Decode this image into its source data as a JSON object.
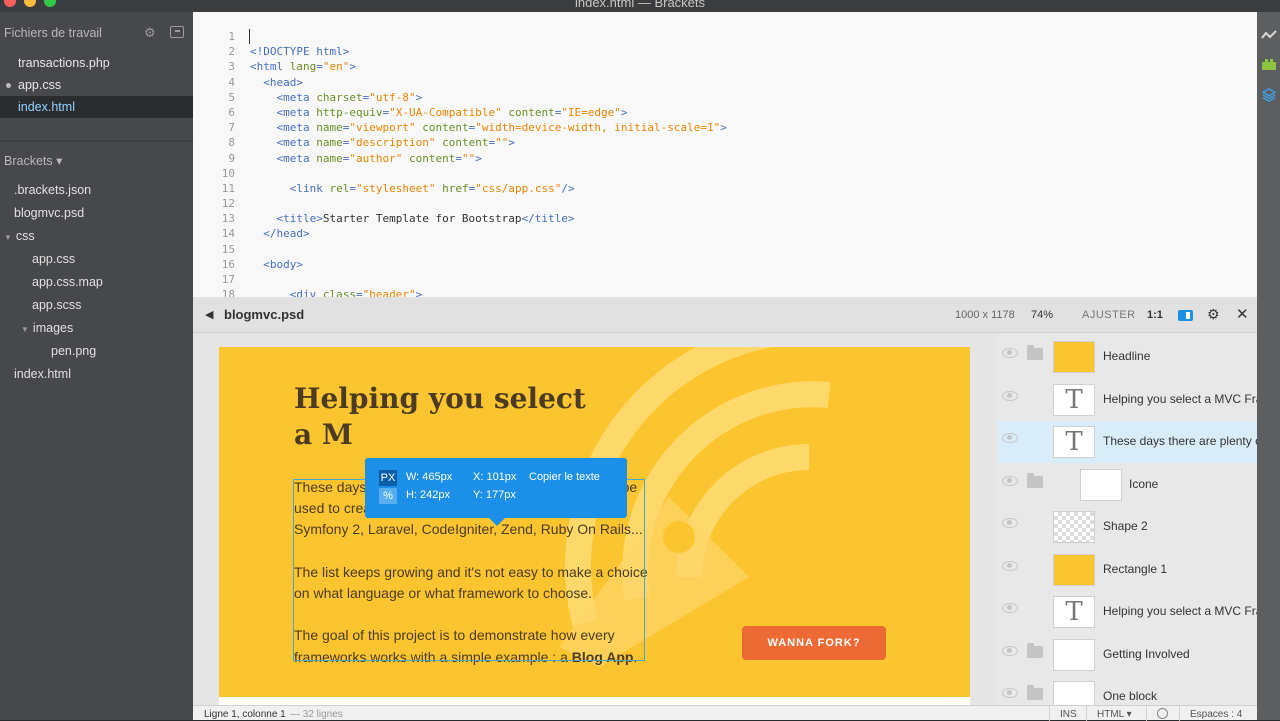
{
  "window": {
    "title": "index.html — Brackets"
  },
  "sidebar": {
    "working_files_header": "Fichiers de travail",
    "working_files": [
      {
        "name": "transactions.php",
        "active": false,
        "modified": false
      },
      {
        "name": "app.css",
        "active": false,
        "modified": true
      },
      {
        "name": "index.html",
        "active": true,
        "modified": false
      }
    ],
    "project_header": "Brackets ▾",
    "tree": [
      {
        "name": ".brackets.json"
      },
      {
        "name": "blogmvc.psd"
      },
      {
        "name": "css"
      },
      {
        "name": "app.css"
      },
      {
        "name": "app.css.map"
      },
      {
        "name": "app.scss"
      },
      {
        "name": "images"
      },
      {
        "name": "pen.png"
      },
      {
        "name": "index.html"
      }
    ]
  },
  "editor": {
    "line_numbers": [
      "1",
      "2",
      "3",
      "4",
      "5",
      "6",
      "7",
      "8",
      "9",
      "10",
      "11",
      "12",
      "13",
      "14",
      "15",
      "16",
      "17",
      "18"
    ],
    "lines": [
      [],
      [
        {
          "t": "tag",
          "v": "<!DOCTYPE html>"
        }
      ],
      [
        {
          "t": "tag",
          "v": "<html "
        },
        {
          "t": "attr",
          "v": "lang"
        },
        {
          "t": "tag",
          "v": "="
        },
        {
          "t": "str",
          "v": "\"en\""
        },
        {
          "t": "tag",
          "v": ">"
        }
      ],
      [
        {
          "t": "p",
          "v": "  "
        },
        {
          "t": "tag",
          "v": "<head>"
        }
      ],
      [
        {
          "t": "p",
          "v": "    "
        },
        {
          "t": "tag",
          "v": "<meta "
        },
        {
          "t": "attr",
          "v": "charset"
        },
        {
          "t": "tag",
          "v": "="
        },
        {
          "t": "str",
          "v": "\"utf-8\""
        },
        {
          "t": "tag",
          "v": ">"
        }
      ],
      [
        {
          "t": "p",
          "v": "    "
        },
        {
          "t": "tag",
          "v": "<meta "
        },
        {
          "t": "attr",
          "v": "http-equiv"
        },
        {
          "t": "tag",
          "v": "="
        },
        {
          "t": "str",
          "v": "\"X-UA-Compatible\""
        },
        {
          "t": "p",
          "v": " "
        },
        {
          "t": "attr",
          "v": "content"
        },
        {
          "t": "tag",
          "v": "="
        },
        {
          "t": "str",
          "v": "\"IE=edge\""
        },
        {
          "t": "tag",
          "v": ">"
        }
      ],
      [
        {
          "t": "p",
          "v": "    "
        },
        {
          "t": "tag",
          "v": "<meta "
        },
        {
          "t": "attr",
          "v": "name"
        },
        {
          "t": "tag",
          "v": "="
        },
        {
          "t": "str",
          "v": "\"viewport\""
        },
        {
          "t": "p",
          "v": " "
        },
        {
          "t": "attr",
          "v": "content"
        },
        {
          "t": "tag",
          "v": "="
        },
        {
          "t": "str",
          "v": "\"width=device-width, initial-scale=1\""
        },
        {
          "t": "tag",
          "v": ">"
        }
      ],
      [
        {
          "t": "p",
          "v": "    "
        },
        {
          "t": "tag",
          "v": "<meta "
        },
        {
          "t": "attr",
          "v": "name"
        },
        {
          "t": "tag",
          "v": "="
        },
        {
          "t": "str",
          "v": "\"description\""
        },
        {
          "t": "p",
          "v": " "
        },
        {
          "t": "attr",
          "v": "content"
        },
        {
          "t": "tag",
          "v": "="
        },
        {
          "t": "str",
          "v": "\"\""
        },
        {
          "t": "tag",
          "v": ">"
        }
      ],
      [
        {
          "t": "p",
          "v": "    "
        },
        {
          "t": "tag",
          "v": "<meta "
        },
        {
          "t": "attr",
          "v": "name"
        },
        {
          "t": "tag",
          "v": "="
        },
        {
          "t": "str",
          "v": "\"author\""
        },
        {
          "t": "p",
          "v": " "
        },
        {
          "t": "attr",
          "v": "content"
        },
        {
          "t": "tag",
          "v": "="
        },
        {
          "t": "str",
          "v": "\"\""
        },
        {
          "t": "tag",
          "v": ">"
        }
      ],
      [],
      [
        {
          "t": "p",
          "v": "      "
        },
        {
          "t": "tag",
          "v": "<link "
        },
        {
          "t": "attr",
          "v": "rel"
        },
        {
          "t": "tag",
          "v": "="
        },
        {
          "t": "str",
          "v": "\"stylesheet\""
        },
        {
          "t": "p",
          "v": " "
        },
        {
          "t": "attr",
          "v": "href"
        },
        {
          "t": "tag",
          "v": "="
        },
        {
          "t": "str",
          "v": "\"css/app.css\""
        },
        {
          "t": "tag",
          "v": "/>"
        }
      ],
      [],
      [
        {
          "t": "p",
          "v": "    "
        },
        {
          "t": "tag",
          "v": "<title>"
        },
        {
          "t": "p",
          "v": "Starter Template for Bootstrap"
        },
        {
          "t": "tag",
          "v": "</title>"
        }
      ],
      [
        {
          "t": "p",
          "v": "  "
        },
        {
          "t": "tag",
          "v": "</head>"
        }
      ],
      [],
      [
        {
          "t": "p",
          "v": "  "
        },
        {
          "t": "tag",
          "v": "<body>"
        }
      ],
      [],
      [
        {
          "t": "p",
          "v": "      "
        },
        {
          "t": "tag",
          "v": "<div "
        },
        {
          "t": "attr",
          "v": "class"
        },
        {
          "t": "tag",
          "v": "="
        },
        {
          "t": "str",
          "v": "\"header\""
        },
        {
          "t": "tag",
          "v": ">"
        }
      ]
    ]
  },
  "preview": {
    "filename": "blogmvc.psd",
    "dimensions": "1000 x 1178",
    "zoom": "74%",
    "fit_label": "AJUSTER",
    "actual_size_label": "1:1",
    "canvas": {
      "headline_line1": "Helping you select",
      "headline_line2": "a M",
      "paragraph1": "These days there are plenty of Frameworks that can be used to create your server side code. CakePHP, Symfony 2, Laravel, CodeIgniter, Zend, Ruby On Rails...",
      "paragraph2": "The list keeps growing and it's not easy to make a choice on what language or what framework to choose.",
      "paragraph3_text": "The goal of this project is to demonstrate how every frameworks works with a simple example : a ",
      "paragraph3_bold": "Blog App",
      "paragraph3_end": ".",
      "fork_button": "WANNA FORK?"
    },
    "tooltip": {
      "px_label": "PX",
      "pct_label": "%",
      "width": "W: 465px",
      "height": "H: 242px",
      "x": "X: 101px",
      "y": "Y: 177px",
      "copy_text": "Copier le texte"
    },
    "layers": [
      {
        "name": "Headline",
        "kind": "folder",
        "thumb": "yellow"
      },
      {
        "name": "Helping you select a MVC Fram",
        "kind": "text",
        "thumb": "t"
      },
      {
        "name": "These days there are plenty of",
        "kind": "text",
        "thumb": "t",
        "selected": true
      },
      {
        "name": "Icone",
        "kind": "folder",
        "thumb": "white"
      },
      {
        "name": "Shape 2",
        "kind": "layer",
        "thumb": "checker"
      },
      {
        "name": "Rectangle 1",
        "kind": "layer",
        "thumb": "yellow"
      },
      {
        "name": "Helping you select a MVC Fram",
        "kind": "text",
        "thumb": "t"
      },
      {
        "name": "Getting Involved",
        "kind": "folder",
        "thumb": "white"
      },
      {
        "name": "One block",
        "kind": "folder",
        "thumb": "white"
      }
    ]
  },
  "statusbar": {
    "position": "Ligne 1, colonne 1",
    "lines": "— 32 lignes",
    "ins": "INS",
    "language": "HTML ▾",
    "indent": "Espaces : 4"
  },
  "colors": {
    "accent_blue": "#1c8fe8",
    "canvas_yellow": "#fcc52f",
    "fork_orange": "#ee6a35",
    "active_file": "#8fd2ff"
  }
}
